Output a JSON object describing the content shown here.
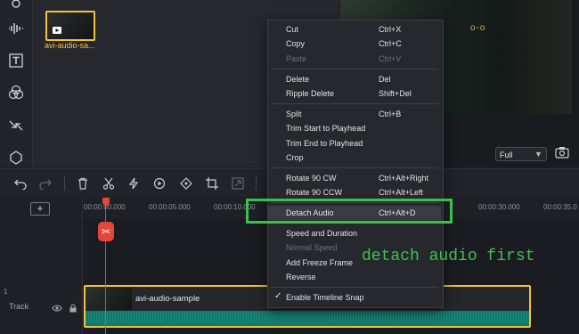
{
  "media": {
    "thumbnail_label": "avi-audio-sa..."
  },
  "preview": {
    "zoom_value": "Full"
  },
  "ruler": {
    "add_label": "+",
    "ticks": [
      "00:00:00.000",
      "00:00:05.000",
      "00:00:10.000",
      "00:00:30.000",
      "00:00:35.0"
    ]
  },
  "track": {
    "number": "1",
    "label": "Track",
    "clip_name": "avi-audio-sample"
  },
  "context_menu": {
    "items": [
      {
        "label": "Cut",
        "shortcut": "Ctrl+X",
        "disabled": false
      },
      {
        "label": "Copy",
        "shortcut": "Ctrl+C",
        "disabled": false
      },
      {
        "label": "Paste",
        "shortcut": "Ctrl+V",
        "disabled": true
      },
      {
        "label": "Delete",
        "shortcut": "Del",
        "disabled": false
      },
      {
        "label": "Ripple Delete",
        "shortcut": "Shift+Del",
        "disabled": false
      },
      {
        "label": "Split",
        "shortcut": "Ctrl+B",
        "disabled": false
      },
      {
        "label": "Trim Start to Playhead",
        "shortcut": "",
        "disabled": false
      },
      {
        "label": "Trim End to Playhead",
        "shortcut": "",
        "disabled": false
      },
      {
        "label": "Crop",
        "shortcut": "",
        "disabled": false
      },
      {
        "label": "Rotate 90 CW",
        "shortcut": "Ctrl+Alt+Right",
        "disabled": false
      },
      {
        "label": "Rotate 90 CCW",
        "shortcut": "Ctrl+Alt+Left",
        "disabled": false
      },
      {
        "label": "Detach Audio",
        "shortcut": "Ctrl+Alt+D",
        "disabled": false,
        "highlighted": true
      },
      {
        "label": "Speed and Duration",
        "shortcut": "",
        "disabled": false
      },
      {
        "label": "Normal Speed",
        "shortcut": "",
        "disabled": true
      },
      {
        "label": "Add Freeze Frame",
        "shortcut": "",
        "disabled": false
      },
      {
        "label": "Reverse",
        "shortcut": "",
        "disabled": false
      },
      {
        "label": "Enable Timeline Snap",
        "shortcut": "",
        "disabled": false,
        "checked": true
      }
    ]
  },
  "annotation": {
    "text": "detach audio first",
    "color": "#3cc44e"
  },
  "colors": {
    "accent_yellow": "#f2c23a",
    "playhead_red": "#e4463b",
    "highlight_green": "#37c24a",
    "audio_teal": "#127a6c"
  }
}
